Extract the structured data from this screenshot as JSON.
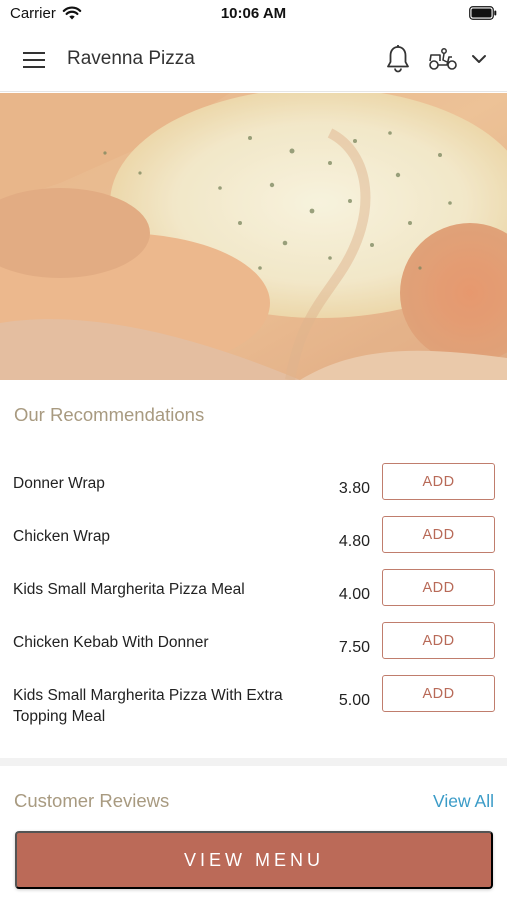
{
  "status_bar": {
    "carrier": "Carrier",
    "time": "10:06 AM"
  },
  "header": {
    "title": "Ravenna Pizza",
    "icons": [
      "menu-icon",
      "bell-icon",
      "scooter-icon",
      "chevron-down-icon"
    ]
  },
  "hero": {
    "image": "pizza-closeup"
  },
  "recommendations": {
    "title": "Our Recommendations",
    "add_label": "ADD",
    "items": [
      {
        "name": "Donner Wrap",
        "price": "3.80"
      },
      {
        "name": "Chicken Wrap",
        "price": "4.80"
      },
      {
        "name": "Kids Small Margherita Pizza Meal",
        "price": "4.00"
      },
      {
        "name": "Chicken Kebab With Donner",
        "price": "7.50"
      },
      {
        "name": "Kids Small Margherita Pizza With Extra Topping Meal",
        "price": "5.00"
      }
    ]
  },
  "reviews": {
    "title": "Customer Reviews",
    "view_all": "View All"
  },
  "footer": {
    "view_menu": "VIEW MENU"
  },
  "colors": {
    "accent": "#bb6a58",
    "section_title": "#a89a80",
    "link": "#3a9bc7"
  }
}
